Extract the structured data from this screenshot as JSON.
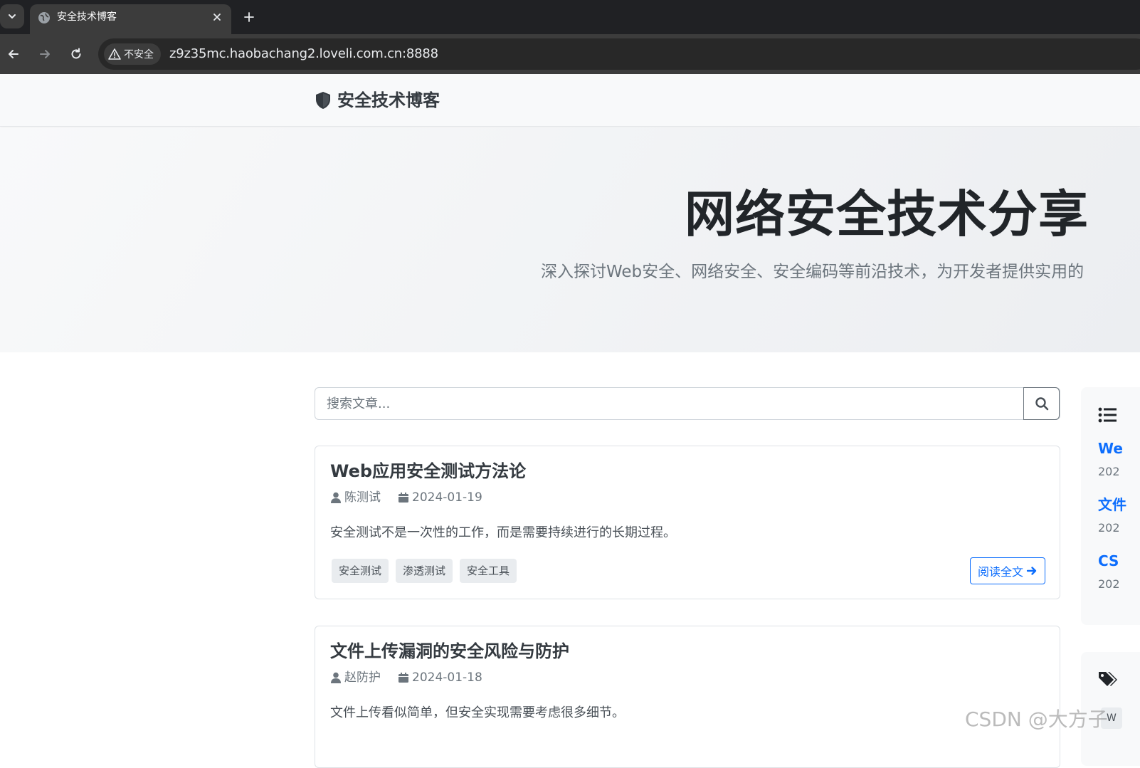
{
  "browser": {
    "tab_title": "安全技术博客",
    "security_label": "不安全",
    "url": "z9z35mc.haobachang2.loveli.com.cn:8888"
  },
  "site": {
    "brand": "安全技术博客",
    "hero_title": "网络安全技术分享",
    "hero_subtitle": "深入探讨Web安全、网络安全、安全编码等前沿技术，为开发者提供实用的"
  },
  "search": {
    "placeholder": "搜索文章..."
  },
  "articles": [
    {
      "title": "Web应用安全测试方法论",
      "author": "陈测试",
      "date": "2024-01-19",
      "excerpt": "安全测试不是一次性的工作，而是需要持续进行的长期过程。",
      "tags": [
        "安全测试",
        "渗透测试",
        "安全工具"
      ],
      "read_more": "阅读全文"
    },
    {
      "title": "文件上传漏洞的安全风险与防护",
      "author": "赵防护",
      "date": "2024-01-18",
      "excerpt": "文件上传看似简单，但安全实现需要考虑很多细节。"
    }
  ],
  "sidebar": {
    "recent": [
      {
        "title": "We",
        "date": "202"
      },
      {
        "title": "文件",
        "date": "202"
      },
      {
        "title": "CS",
        "date": "202"
      }
    ],
    "tag_partial": "W"
  },
  "watermark": "CSDN @大方子",
  "colors": {
    "primary": "#0d6efd",
    "chrome_dark": "#202124",
    "chrome_toolbar": "#3c3c3c",
    "muted": "#6c757d"
  }
}
